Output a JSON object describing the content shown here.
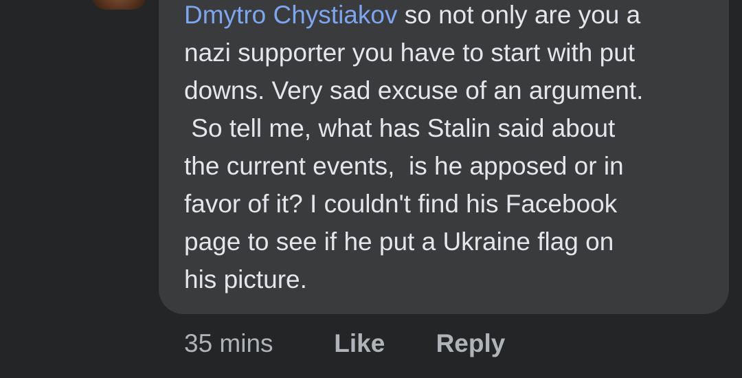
{
  "comment": {
    "author_mention": "Dmytro Chystiakov",
    "text": " so not only are you a\nnazi supporter you have to start with put\ndowns. Very sad excuse of an argument.\n So tell me, what has Stalin said about\nthe current events,  is he apposed or in\nfavor of it? I couldn't find his Facebook\npage to see if he put a Ukraine flag on\nhis picture."
  },
  "actions": {
    "timestamp": "35 mins",
    "like_label": "Like",
    "reply_label": "Reply"
  },
  "colors": {
    "background": "#242526",
    "bubble": "#3a3b3c",
    "text": "#e4e6eb",
    "mention": "#7ea6f0",
    "secondary": "#b0b3b8"
  }
}
